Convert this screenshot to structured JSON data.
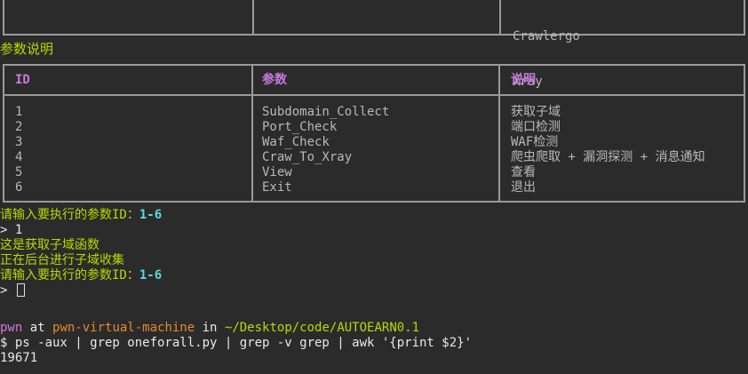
{
  "top_table": {
    "lines": [
      "Crawlergo",
      "Xray"
    ]
  },
  "section_title": "参数说明",
  "param_table": {
    "headers": [
      "ID",
      "参数",
      "说明"
    ],
    "ids": [
      "1",
      "2",
      "3",
      "4",
      "5",
      "6"
    ],
    "params": [
      "Subdomain_Collect",
      "Port_Check",
      "Waf_Check",
      "Craw_To_Xray",
      "View",
      "Exit"
    ],
    "descriptions": [
      "获取子域",
      "端口检测",
      "WAF检测",
      "爬虫爬取 + 漏洞探测 + 消息通知",
      "查看",
      "退出"
    ]
  },
  "output": {
    "prompt1_text": "请输入要执行的参数ID：",
    "prompt1_range": "1-6",
    "input1": "> 1",
    "msg1": "这是获取子域函数",
    "msg2": "正在后台进行子域收集",
    "prompt2_text": "请输入要执行的参数ID：",
    "prompt2_range": "1-6",
    "input2": "> "
  },
  "shell": {
    "user": "pwn",
    "at": " at ",
    "host": "pwn-virtual-machine",
    "in": " in ",
    "path": "~/Desktop/code/AUTOEARN0.1",
    "command": "$ ps -aux | grep oneforall.py | grep -v grep | awk '{print $2}'",
    "result": "19671"
  },
  "colors": {
    "green": "#b7d900",
    "cyan": "#5fd7d7",
    "orange": "#e5892b",
    "purple": "#d676d6",
    "header_purple": "#c678dd",
    "border": "#9a9a9a",
    "background": "#2b2b2b"
  }
}
